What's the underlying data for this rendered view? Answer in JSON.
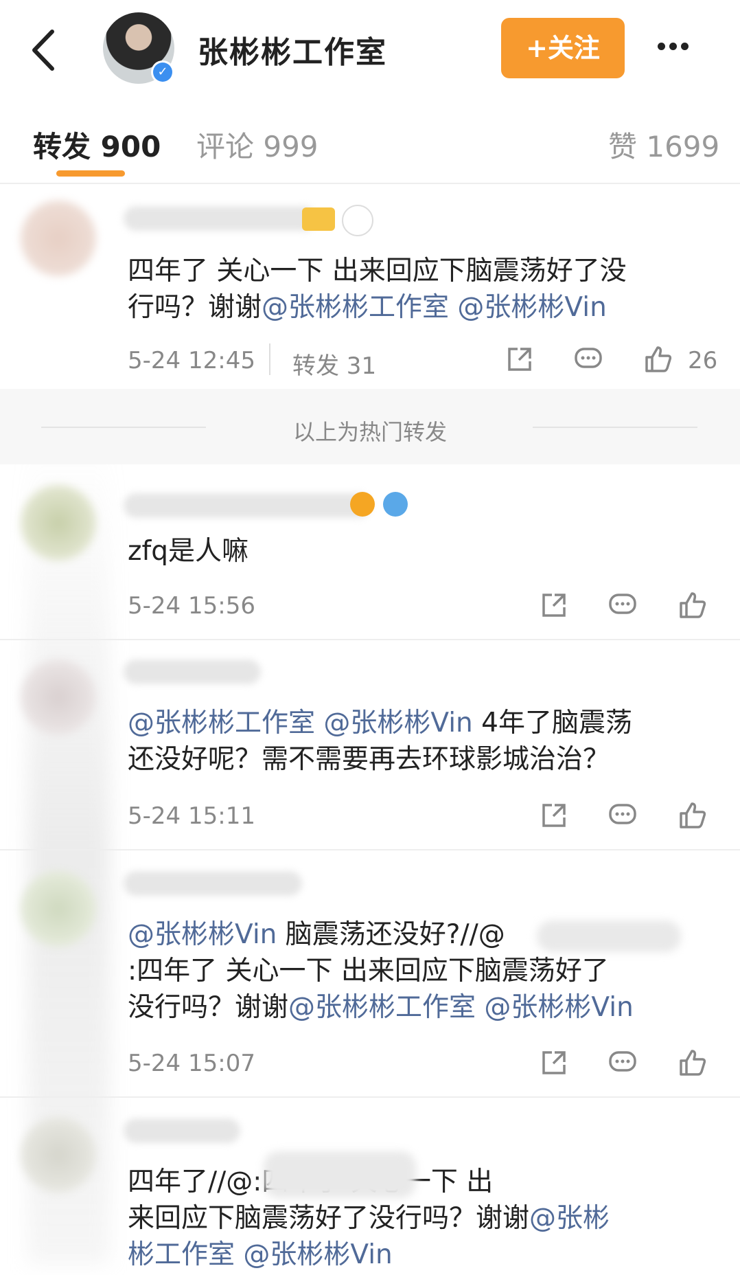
{
  "header": {
    "account_name": "张彬彬工作室",
    "follow_label": "+关注",
    "back_icon": "chevron-left-icon",
    "more_icon": "more-dots-icon",
    "verified_badge": "✓"
  },
  "tabs": [
    {
      "label": "转发 900"
    },
    {
      "label": "评论 999"
    },
    {
      "label": "赞 1699"
    }
  ],
  "colors": {
    "accent": "#f79a2f",
    "mention": "#506a98",
    "meta": "#888888"
  },
  "hot_divider_label": "以上为热门转发",
  "reposts": [
    {
      "text_lines": [
        "四年了 关心一下 出来回应下脑震荡好了没",
        "行吗？谢谢"
      ],
      "mentions_line2": "@张彬彬工作室 @张彬彬Vin",
      "time": "5-24 12:45",
      "repost_count": "转发 31",
      "like_count": "26"
    },
    {
      "text": "zfq是人嘛",
      "time": "5-24 15:56"
    },
    {
      "line1_mention": "@张彬彬工作室 @张彬彬Vin",
      "line1_rest": " 4年了脑震荡",
      "line2": "还没好呢？需不需要再去环球影城治治？",
      "time": "5-24 15:11"
    },
    {
      "line1_mention": "@张彬彬Vin",
      "line1_rest": " 脑震荡还没好?//@",
      "line2": ":四年了 关心一下 出来回应下脑震荡好了",
      "line3_pre": "没行吗？谢谢",
      "line3_mention": "@张彬彬工作室 @张彬彬Vin",
      "time": "5-24 15:07"
    },
    {
      "line1_pre": "四年了//@",
      "line1_rest": ":四年了 关心一下 出",
      "line2_pre": "来回应下脑震荡好了没行吗？谢谢",
      "line2_mention": "@张彬",
      "line3_mention": "彬工作室 @张彬彬Vin"
    }
  ]
}
